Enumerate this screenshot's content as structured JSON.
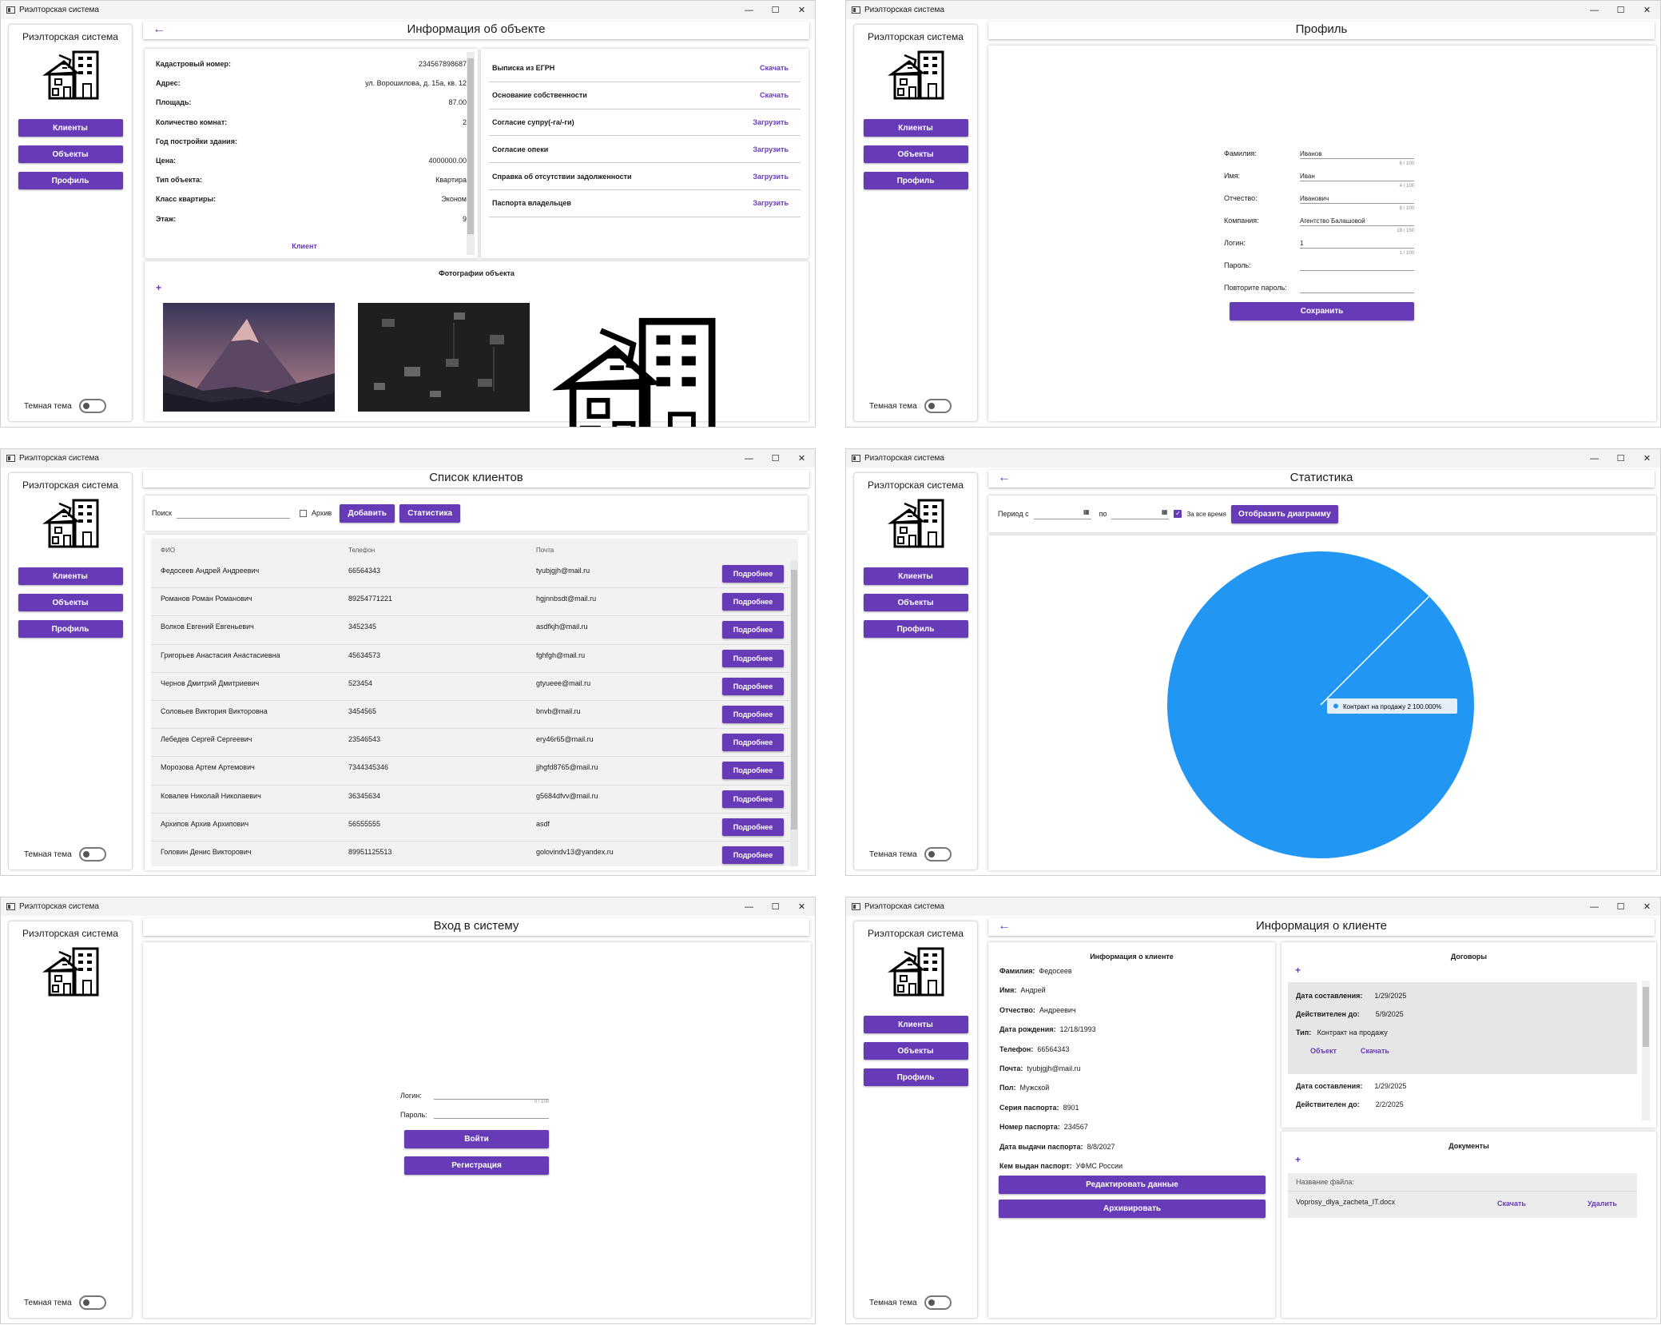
{
  "window": {
    "title": "Риэлторская система",
    "minimize": "—",
    "maximize": "☐",
    "close": "✕"
  },
  "sidebar": {
    "brand": "Риэлторская система",
    "nav": {
      "clients": "Клиенты",
      "objects": "Объекты",
      "profile": "Профиль"
    },
    "theme_label": "Темная тема",
    "logo_icon": "house-building-icon"
  },
  "object_info": {
    "title": "Информация об объекте",
    "back": "←",
    "fields": [
      {
        "label": "Кадастровый номер:",
        "value": "234567898687"
      },
      {
        "label": "Адрес:",
        "value": "ул. Ворошилова, д. 15а, кв. 12"
      },
      {
        "label": "Площадь:",
        "value": "87.00"
      },
      {
        "label": "Количество комнат:",
        "value": "2"
      },
      {
        "label": "Год постройки здания:",
        "value": ""
      },
      {
        "label": "Цена:",
        "value": "4000000.00"
      },
      {
        "label": "Тип объекта:",
        "value": "Квартира"
      },
      {
        "label": "Класс квартиры:",
        "value": "Эконом"
      },
      {
        "label": "Этаж:",
        "value": "9"
      }
    ],
    "client_link": "Клиент",
    "documents": [
      {
        "name": "Выписка из ЕГРН",
        "action": "Скачать"
      },
      {
        "name": "Основание собственности",
        "action": "Скачать"
      },
      {
        "name": "Согласие супру(-га/-ги)",
        "action": "Загрузить"
      },
      {
        "name": "Согласие опеки",
        "action": "Загрузить"
      },
      {
        "name": "Справка об отсутствии задолженности",
        "action": "Загрузить"
      },
      {
        "name": "Паспорта владельцев",
        "action": "Загрузить"
      }
    ],
    "photos_title": "Фотографии объекта",
    "add": "+"
  },
  "profile": {
    "title": "Профиль",
    "fields": [
      {
        "label": "Фамилия:",
        "value": "Иванов",
        "counter": "6 / 100"
      },
      {
        "label": "Имя:",
        "value": "Иван",
        "counter": "4 / 100"
      },
      {
        "label": "Отчество:",
        "value": "Иванович",
        "counter": "8 / 100"
      },
      {
        "label": "Компания:",
        "value": "Агентство Балашовой",
        "counter": "19 / 150"
      },
      {
        "label": "Логин:",
        "value": "1",
        "counter": "1 / 100"
      },
      {
        "label": "Пароль:",
        "value": "",
        "counter": ""
      },
      {
        "label": "Повторите пароль:",
        "value": "",
        "counter": ""
      }
    ],
    "save": "Сохранить"
  },
  "clients": {
    "title": "Список клиентов",
    "search_label": "Поиск",
    "archive_label": "Архив",
    "add": "Добавить",
    "stats": "Статистика",
    "columns": [
      "ФИО",
      "Телефон",
      "Почта"
    ],
    "more": "Подробнее",
    "rows": [
      [
        "Федосеев Андрей Андреевич",
        "66564343",
        "tyubjgjh@mail.ru"
      ],
      [
        "Романов Роман Романович",
        "89254771221",
        "hgjnnbsdt@mail.ru"
      ],
      [
        "Волков Евгений Евгеньевич",
        "3452345",
        "asdfkjh@mail.ru"
      ],
      [
        "Григорьев Анастасия Анастасиевна",
        "45634573",
        "fghfgh@mail.ru"
      ],
      [
        "Чернов Дмитрий Дмитриевич",
        "523454",
        "gtyueee@mail.ru"
      ],
      [
        "Соловьев Виктория Викторовна",
        "3454565",
        "bnvb@mail.ru"
      ],
      [
        "Лебедев Сергей Сергеевич",
        "23546543",
        "ery46r65@mail.ru"
      ],
      [
        "Морозова Артем Артемович",
        "7344345346",
        "jjhgfd8765@mail.ru"
      ],
      [
        "Ковалев Николай Николаевич",
        "36345634",
        "g5684dfvv@mail.ru"
      ],
      [
        "Архипов Архив Архипович",
        "56555555",
        "asdf"
      ],
      [
        "Головин Денис Викторович",
        "89951125513",
        "golovindv13@yandex.ru"
      ]
    ]
  },
  "statistics": {
    "title": "Статистика",
    "period_from": "Период с",
    "period_to": "по",
    "all_time": "За все время",
    "show": "Отобразить диаграмму",
    "slice_color": "#2196f3"
  },
  "chart_data": {
    "type": "pie",
    "categories": [
      "Контракт на продажу"
    ],
    "values": [
      2
    ],
    "percent": [
      "100.000%"
    ],
    "tooltip": "Контракт на продажу  2  100.000%"
  },
  "login": {
    "title": "Вход в систему",
    "login_label": "Логин:",
    "password_label": "Пароль:",
    "counter": "0 / 100",
    "enter": "Войти",
    "register": "Регистрация"
  },
  "client_info": {
    "title": "Информация о клиенте",
    "back": "←",
    "section": "Информация о клиенте",
    "fields": [
      {
        "label": "Фамилия:",
        "value": "Федосеев"
      },
      {
        "label": "Имя:",
        "value": "Андрей"
      },
      {
        "label": "Отчество:",
        "value": "Андреевич"
      },
      {
        "label": "Дата рождения:",
        "value": "12/18/1993"
      },
      {
        "label": "Телефон:",
        "value": "66564343"
      },
      {
        "label": "Почта:",
        "value": "tyubjgjh@mail.ru"
      },
      {
        "label": "Пол:",
        "value": "Мужской"
      },
      {
        "label": "Серия паспорта:",
        "value": "8901"
      },
      {
        "label": "Номер паспорта:",
        "value": "234567"
      },
      {
        "label": "Дата выдачи паспорта:",
        "value": "8/8/2027"
      },
      {
        "label": "Кем выдан паспорт:",
        "value": "УФМС России"
      }
    ],
    "edit": "Редактировать данные",
    "archive": "Архивировать",
    "contracts_title": "Договоры",
    "contract1": {
      "date_label": "Дата составления:",
      "date": "1/29/2025",
      "valid_label": "Действителен до:",
      "valid": "5/9/2025",
      "type_label": "Тип:",
      "type": "Контракт на продажу",
      "obj": "Объект",
      "dl": "Скачать"
    },
    "contract2": {
      "date_label": "Дата составления:",
      "date": "1/29/2025",
      "valid_label": "Действителен до:",
      "valid": "2/2/2025"
    },
    "docs_title": "Документы",
    "file_header": "Название файла:",
    "file": "Voprosy_dlya_zacheta_IT.docx",
    "download": "Скачать",
    "delete": "Удалить",
    "add": "+"
  }
}
